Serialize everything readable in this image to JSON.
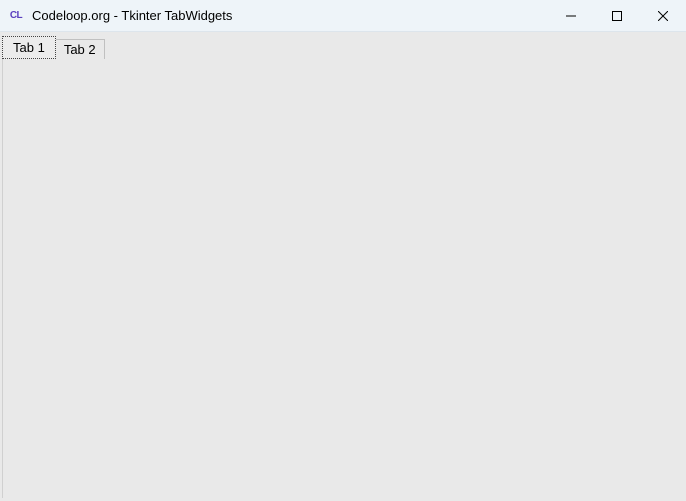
{
  "window": {
    "title": "Codeloop.org - Tkinter TabWidgets",
    "icon_text": "CL"
  },
  "tabs": [
    {
      "label": "Tab 1",
      "active": true
    },
    {
      "label": "Tab 2",
      "active": false
    }
  ]
}
